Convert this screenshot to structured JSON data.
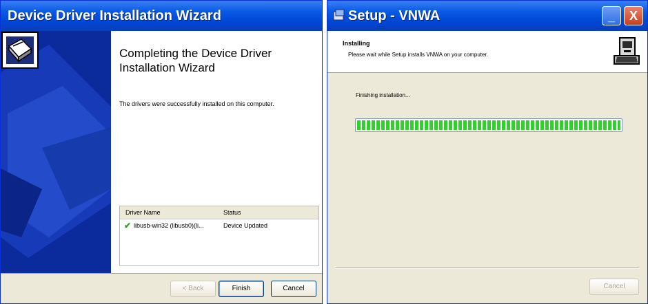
{
  "wizard": {
    "title": "Device Driver Installation Wizard",
    "heading": "Completing the Device Driver Installation Wizard",
    "message": "The drivers were successfully installed on this computer.",
    "table": {
      "columns": [
        "Driver Name",
        "Status"
      ],
      "rows": [
        {
          "name": "libusb-win32 (libusb0)(li...",
          "status": "Device Updated"
        }
      ]
    },
    "buttons": {
      "back": "< Back",
      "finish": "Finish",
      "cancel": "Cancel"
    }
  },
  "setup": {
    "title": "Setup - VNWA",
    "step_title": "Installing",
    "step_subtitle": "Please wait while Setup installs VNWA on your computer.",
    "status": "Finishing installation...",
    "progress": 1.0,
    "buttons": {
      "cancel": "Cancel"
    },
    "titlebar_buttons": {
      "minimize": "_",
      "close": "X"
    }
  },
  "colors": {
    "titlebar": "#0a5ae6",
    "sidebar": "#0b2a9c",
    "progress": "#2fd12a",
    "dialog": "#ece9d8"
  }
}
